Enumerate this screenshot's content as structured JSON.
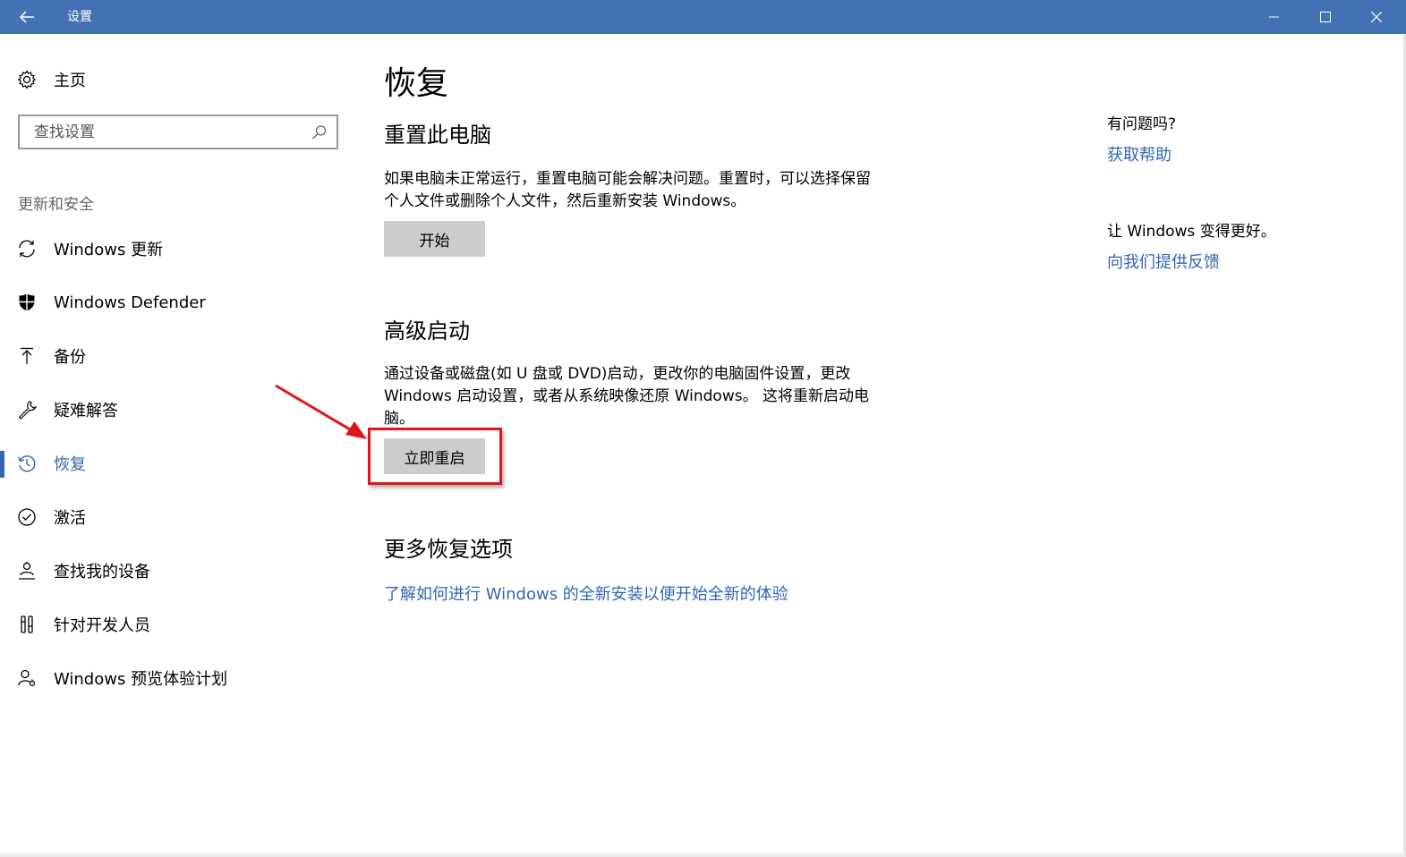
{
  "window": {
    "title": "设置"
  },
  "sidebar": {
    "home_label": "主页",
    "search_placeholder": "查找设置",
    "section_label": "更新和安全",
    "items": [
      {
        "label": "Windows 更新",
        "icon": "sync-icon"
      },
      {
        "label": "Windows Defender",
        "icon": "shield-icon"
      },
      {
        "label": "备份",
        "icon": "upload-arrow-icon"
      },
      {
        "label": "疑难解答",
        "icon": "wrench-icon"
      },
      {
        "label": "恢复",
        "icon": "history-icon",
        "active": true
      },
      {
        "label": "激活",
        "icon": "check-circle-icon"
      },
      {
        "label": "查找我的设备",
        "icon": "locate-person-icon"
      },
      {
        "label": "针对开发人员",
        "icon": "developer-tools-icon"
      },
      {
        "label": "Windows 预览体验计划",
        "icon": "person-insider-icon"
      }
    ]
  },
  "main": {
    "title": "恢复",
    "reset": {
      "heading": "重置此电脑",
      "description": "如果电脑未正常运行，重置电脑可能会解决问题。重置时，可以选择保留个人文件或删除个人文件，然后重新安装 Windows。",
      "button_label": "开始"
    },
    "advanced": {
      "heading": "高级启动",
      "description": "通过设备或磁盘(如 U 盘或 DVD)启动，更改你的电脑固件设置，更改 Windows 启动设置，或者从系统映像还原 Windows。 这将重新启动电脑。",
      "button_label": "立即重启"
    },
    "more": {
      "heading": "更多恢复选项",
      "link": "了解如何进行 Windows 的全新安装以便开始全新的体验"
    }
  },
  "aside": {
    "question": "有问题吗?",
    "help_link": "获取帮助",
    "feedback_prompt": "让 Windows 变得更好。",
    "feedback_link": "向我们提供反馈"
  },
  "colors": {
    "titlebar": "#4272b4",
    "accent": "#3365b0",
    "annotation": "#e0151b",
    "button": "#cccccc"
  }
}
